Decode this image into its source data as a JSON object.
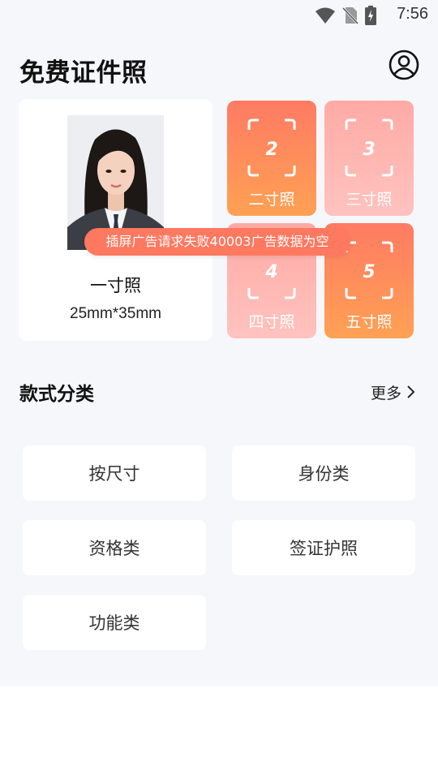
{
  "status_bar": {
    "time": "7:56",
    "icons": [
      "wifi-icon",
      "no-sim-icon",
      "battery-charging-icon"
    ]
  },
  "header": {
    "title": "免费证件照",
    "profile_icon": "user-circle-icon"
  },
  "featured": {
    "label": "一寸照",
    "dimensions": "25mm*35mm"
  },
  "sizes": [
    {
      "label": "二寸照",
      "number": "2",
      "style": "orange"
    },
    {
      "label": "三寸照",
      "number": "3",
      "style": "pink"
    },
    {
      "label": "四寸照",
      "number": "4",
      "style": "pink"
    },
    {
      "label": "五寸照",
      "number": "5",
      "style": "orange"
    }
  ],
  "toast": "插屏广告请求失败40003广告数据为空",
  "categories": {
    "title": "款式分类",
    "more_label": "更多",
    "items": [
      "按尺寸",
      "身份类",
      "资格类",
      "签证护照",
      "功能类"
    ]
  },
  "colors": {
    "accent": "#ff7b63",
    "accent_end": "#ffa154",
    "pink": "#ffaaa5",
    "background": "#f6f7fa"
  }
}
